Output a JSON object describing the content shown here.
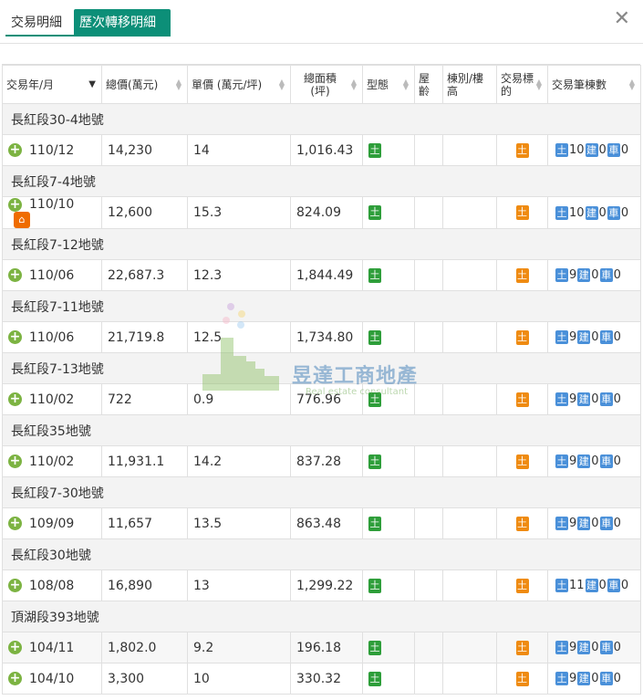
{
  "tabs": [
    {
      "label": "交易明細",
      "active": false
    },
    {
      "label": "歷次轉移明細",
      "active": true
    }
  ],
  "close_label": "✕",
  "columns": [
    {
      "label": "交易年/月",
      "sort": "active"
    },
    {
      "label": "總價(萬元)",
      "sort": "both"
    },
    {
      "label": "單價 (萬元/坪)",
      "sort": "both"
    },
    {
      "label": "總面積\n(坪)",
      "sort": "both"
    },
    {
      "label": "型態",
      "sort": "both"
    },
    {
      "label": "屋齡",
      "sort": "none"
    },
    {
      "label": "棟別/樓高",
      "sort": "none"
    },
    {
      "label": "交易標的",
      "sort": "both"
    },
    {
      "label": "交易筆棟數",
      "sort": "both"
    }
  ],
  "groups": [
    {
      "name": "長紅段30-4地號",
      "rows": [
        {
          "ym": "110/12",
          "total": "14,230",
          "unit": "14",
          "area": "1,016.43",
          "type": "土",
          "target": "土",
          "land": "10",
          "bldg": "0",
          "car": "0",
          "house": false
        }
      ]
    },
    {
      "name": "長紅段7-4地號",
      "rows": [
        {
          "ym": "110/10",
          "total": "12,600",
          "unit": "15.3",
          "area": "824.09",
          "type": "土",
          "target": "土",
          "land": "10",
          "bldg": "0",
          "car": "0",
          "house": true
        }
      ]
    },
    {
      "name": "長紅段7-12地號",
      "rows": [
        {
          "ym": "110/06",
          "total": "22,687.3",
          "unit": "12.3",
          "area": "1,844.49",
          "type": "土",
          "target": "土",
          "land": "9",
          "bldg": "0",
          "car": "0",
          "house": false
        }
      ]
    },
    {
      "name": "長紅段7-11地號",
      "rows": [
        {
          "ym": "110/06",
          "total": "21,719.8",
          "unit": "12.5",
          "area": "1,734.80",
          "type": "土",
          "target": "土",
          "land": "9",
          "bldg": "0",
          "car": "0",
          "house": false
        }
      ]
    },
    {
      "name": "長紅段7-13地號",
      "rows": [
        {
          "ym": "110/02",
          "total": "722",
          "unit": "0.9",
          "area": "776.96",
          "type": "土",
          "target": "土",
          "land": "9",
          "bldg": "0",
          "car": "0",
          "house": false
        }
      ]
    },
    {
      "name": "長紅段35地號",
      "rows": [
        {
          "ym": "110/02",
          "total": "11,931.1",
          "unit": "14.2",
          "area": "837.28",
          "type": "土",
          "target": "土",
          "land": "9",
          "bldg": "0",
          "car": "0",
          "house": false
        }
      ]
    },
    {
      "name": "長紅段7-30地號",
      "rows": [
        {
          "ym": "109/09",
          "total": "11,657",
          "unit": "13.5",
          "area": "863.48",
          "type": "土",
          "target": "土",
          "land": "9",
          "bldg": "0",
          "car": "0",
          "house": false
        }
      ]
    },
    {
      "name": "長紅段30地號",
      "rows": [
        {
          "ym": "108/08",
          "total": "16,890",
          "unit": "13",
          "area": "1,299.22",
          "type": "土",
          "target": "土",
          "land": "11",
          "bldg": "0",
          "car": "0",
          "house": false
        }
      ]
    },
    {
      "name": "頂湖段393地號",
      "rows": [
        {
          "ym": "104/11",
          "total": "1,802.0",
          "unit": "9.2",
          "area": "196.18",
          "type": "土",
          "target": "土",
          "land": "9",
          "bldg": "0",
          "car": "0",
          "house": false
        },
        {
          "ym": "104/10",
          "total": "3,300",
          "unit": "10",
          "area": "330.32",
          "type": "土",
          "target": "土",
          "land": "9",
          "bldg": "0",
          "car": "0",
          "house": false
        }
      ]
    }
  ],
  "badges": {
    "land": "土",
    "bldg": "建",
    "car": "車"
  },
  "watermark": {
    "name": "昱達工商地產",
    "sub": "Real estate consultant"
  },
  "colors": {
    "accent": "#0c8f78",
    "type_green": "#2e9e3a",
    "target_orange": "#ef8b12",
    "count_blue": "#4a90d9",
    "plus_green": "#7cb342"
  }
}
